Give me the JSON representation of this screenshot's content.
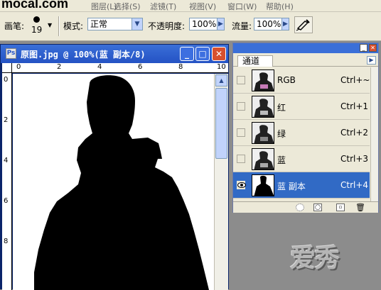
{
  "menubar": {
    "logo": "mocal.com",
    "items": [
      "图层",
      "选择",
      "滤镜",
      "视图",
      "窗口",
      "帮助"
    ],
    "shortcuts": [
      "(L)",
      "(S)",
      "(T)",
      "(V)",
      "(W)",
      "(H)"
    ]
  },
  "options": {
    "brush_label": "画笔:",
    "brush_size": "19",
    "mode_label": "模式:",
    "mode_value": "正常",
    "opacity_label": "不透明度:",
    "opacity_value": "100%",
    "flow_label": "流量:",
    "flow_value": "100%"
  },
  "document": {
    "title": "原图.jpg @ 100%(蓝 副本/8)",
    "ruler_h": [
      "0",
      "2",
      "4",
      "6",
      "8",
      "10"
    ],
    "ruler_v": [
      "0",
      "2",
      "4",
      "6",
      "8"
    ],
    "minimize_icon": "minimize-icon",
    "maximize_icon": "maximize-icon",
    "close_icon": "close-icon"
  },
  "channels": {
    "tab": "通道",
    "rows": [
      {
        "name": "RGB",
        "shortcut": "Ctrl+~",
        "visible": false,
        "selected": false
      },
      {
        "name": "红",
        "shortcut": "Ctrl+1",
        "visible": false,
        "selected": false
      },
      {
        "name": "绿",
        "shortcut": "Ctrl+2",
        "visible": false,
        "selected": false
      },
      {
        "name": "蓝",
        "shortcut": "Ctrl+3",
        "visible": false,
        "selected": false
      },
      {
        "name": "蓝 副本",
        "shortcut": "Ctrl+4",
        "visible": true,
        "selected": true
      }
    ],
    "footer_icons": [
      "load-selection-icon",
      "save-selection-icon",
      "new-channel-icon",
      "delete-channel-icon"
    ]
  },
  "watermark": "爱秀",
  "colors": {
    "title_bar": "#2a5bd0",
    "selection": "#316ac5",
    "panel_bg": "#ece9d8"
  }
}
